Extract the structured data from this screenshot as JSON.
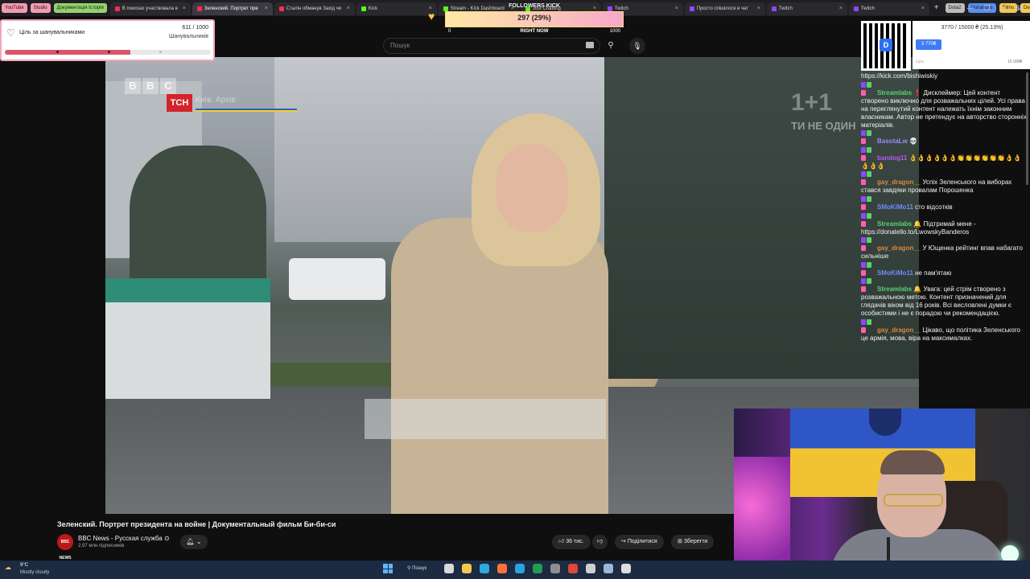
{
  "browser": {
    "bookmarks": [
      {
        "label": "YouTube",
        "color": "#f49ab0"
      },
      {
        "label": "Studio",
        "color": "#f49ab0"
      },
      {
        "label": "Документація Історія",
        "color": "#92d36e"
      }
    ],
    "tabs": [
      {
        "label": "В поисках участвовала в",
        "color": "#ff2a55"
      },
      {
        "label": "Зеленский. Портрет пре",
        "color": "#ff2a55",
        "active": true
      },
      {
        "label": "Сталін обманув Захід чи",
        "color": "#ff2a55"
      },
      {
        "label": "Kick",
        "color": "#53fc18"
      },
      {
        "label": "Stream - Kick Dashboard",
        "color": "#53fc18"
      },
      {
        "label": "Just Chatting",
        "color": "#53fc18"
      },
      {
        "label": "Twitch",
        "color": "#9146ff"
      },
      {
        "label": "Просто спішілося в чат",
        "color": "#9146ff"
      },
      {
        "label": "Twitch",
        "color": "#9146ff"
      },
      {
        "label": "Twitch",
        "color": "#9146ff"
      }
    ],
    "right_bookmarks": [
      {
        "label": "Dota2",
        "color": "#bcbcbc"
      },
      {
        "label": "Donations",
        "color": "#5a8ef0"
      },
      {
        "label": "Films",
        "color": "#f2c94c"
      },
      {
        "label": "DeepState",
        "color": "#f2c94c"
      }
    ],
    "tab_close": "×",
    "new_tab": "+",
    "window_controls": [
      "—",
      "❐",
      "✕"
    ],
    "profile_badge": "68"
  },
  "youtube": {
    "search_placeholder": "Пошук",
    "video_title": "Зеленский. Портрет президента на войне | Документальный фильм Би-би-си",
    "channel_name": "BBC News - Русская служба ⊙",
    "channel_subs": "2,97 млн підписників",
    "avatar_text": "BBC NEWS",
    "likes": "36 тис.",
    "share_label": "Поділитися",
    "save_label": "Зберегти",
    "watermark_tsn": "ТСН",
    "watermark_1plus1": "1+1",
    "watermark_slogan": "ТИ НЕ ОДИН",
    "bbc_letters": [
      "B",
      "B",
      "C"
    ],
    "overlay_faint_text": "Київ. Архів"
  },
  "follower_goal": {
    "title": "Ціль за шанувальниками",
    "count": "611 / 1000",
    "subtitle": "Шанувальників",
    "progress": 0.611,
    "bar_color": "#d9566b"
  },
  "followers_kick": {
    "title": "FOLLOWERS KICK",
    "value": "297 (29%)",
    "min": "0",
    "now_label": "RIGHT NOW",
    "max": "1000",
    "progress": 0.297
  },
  "donation": {
    "progress_text": "3770 / 15000 ₴ (25.13%)",
    "amount_button": "3 770₴",
    "min_label": "Ціль",
    "max_label": "15 000₴",
    "qr_center": "D"
  },
  "chat": {
    "messages": [
      {
        "user": "",
        "color": "#ffffff",
        "text": "https://kick.com/bishiwiskiy"
      },
      {
        "user": "Streamlabs",
        "color": "#57d46b",
        "text": "❗ Дисклеймер: Цей контент створено виключно для розважальних цілей. Усі права на переглянутий контент належать їхнім законним власникам. Автор не претендує на авторство сторонніх матеріалів."
      },
      {
        "user": "BasotaLw",
        "color": "#9b8cff",
        "text": "💀"
      },
      {
        "user": "bandog11",
        "color": "#b05cf0",
        "text": "👌👌👌👌👌👌👏👏👏👏👏👏👌👌👌👌👌"
      },
      {
        "user": "gay_dragon__",
        "color": "#d98a3a",
        "text": "Успіх Зеленського на виборах стався завдяки провалам Порошенка"
      },
      {
        "user": "SMoKiMo11",
        "color": "#6f8cff",
        "text": "сто відсотків"
      },
      {
        "user": "Streamlabs",
        "color": "#57d46b",
        "text": "🔔 Підтримай мене - https://donatello.to/LwowskyBanderos"
      },
      {
        "user": "gay_dragon__",
        "color": "#d98a3a",
        "text": "У Ющенка рейтинг впав набагато сильніше"
      },
      {
        "user": "SMoKiMo11",
        "color": "#6f8cff",
        "text": "не пам'ятаю"
      },
      {
        "user": "Streamlabs",
        "color": "#57d46b",
        "text": "🔔 Увага: цей стрім створено з розважальною метою. Контент призначений для глядачів віком від 16 років. Всі висловлені думки є особистими і не є порадою чи рекомендацією."
      },
      {
        "user": "gay_dragon__",
        "color": "#d98a3a",
        "text": "Цікаво, що політика Зеленського це армія, мова, віра на максималках."
      }
    ]
  },
  "taskbar": {
    "temp": "9°C",
    "weather": "Mostly cloudy",
    "search_label": "Пошук",
    "icons": [
      {
        "name": "task-view-icon",
        "color": "#d9d9d9"
      },
      {
        "name": "file-explorer-icon",
        "color": "#f2c94c"
      },
      {
        "name": "edge-icon",
        "color": "#2fa8e0"
      },
      {
        "name": "firefox-icon",
        "color": "#ff7139"
      },
      {
        "name": "telegram-icon",
        "color": "#2aa3e0"
      },
      {
        "name": "excel-icon",
        "color": "#1f9d55"
      },
      {
        "name": "app-icon",
        "color": "#8e8e8e"
      },
      {
        "name": "chrome-icon",
        "color": "#e0463b"
      },
      {
        "name": "settings-icon",
        "color": "#cfcfcf"
      },
      {
        "name": "steam-icon",
        "color": "#9ab7d6"
      },
      {
        "name": "obs-icon",
        "color": "#dddddd"
      }
    ]
  }
}
